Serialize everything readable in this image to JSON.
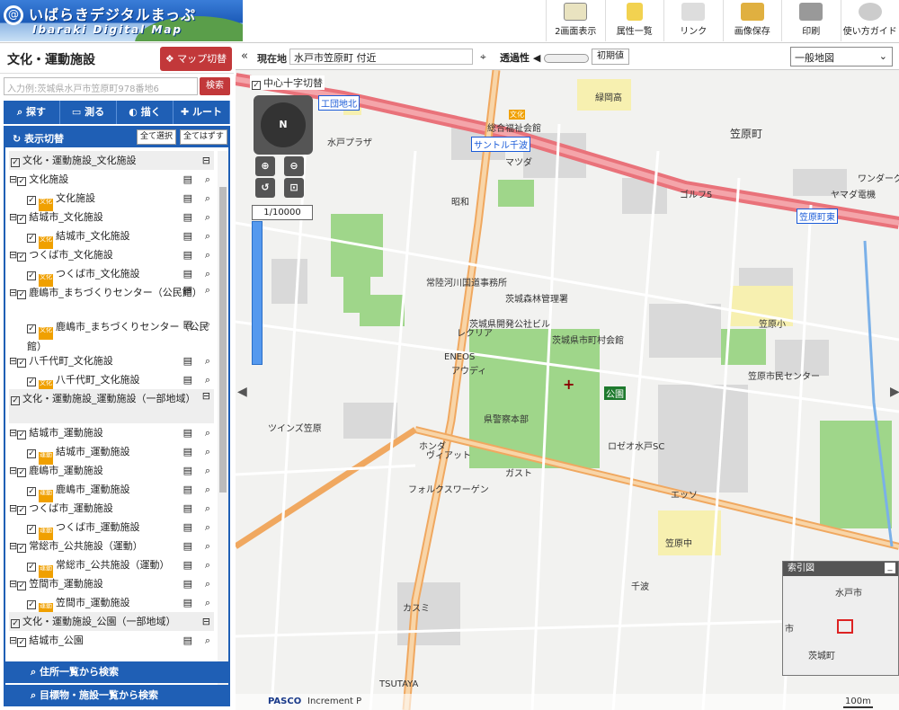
{
  "header": {
    "logo_main": "いばらきデジタルまっぷ",
    "logo_sub": "Ibaraki Digital Map",
    "toolbar": [
      "2画面表示",
      "属性一覧",
      "リンク",
      "画像保存",
      "印刷",
      "使い方ガイド"
    ]
  },
  "panel": {
    "title": "文化・運動施設",
    "map_switch": "マップ切替",
    "search_placeholder": "入力例:茨城県水戸市笠原町978番地6",
    "search_button": "検索",
    "tools": [
      "探す",
      "測る",
      "描く",
      "ルート"
    ],
    "display_toggle": "表示切替",
    "select_all": "全て選択",
    "deselect_all": "全てはずす",
    "badge_culture": "文化",
    "badge_sports": "運動",
    "rows": [
      {
        "type": "group",
        "label": "文化・運動施設_文化施設"
      },
      {
        "type": "parent",
        "label": "文化施設"
      },
      {
        "type": "child",
        "label": "文化施設",
        "badge": "culture"
      },
      {
        "type": "parent",
        "label": "結城市_文化施設"
      },
      {
        "type": "child",
        "label": "結城市_文化施設",
        "badge": "culture"
      },
      {
        "type": "parent",
        "label": "つくば市_文化施設"
      },
      {
        "type": "child",
        "label": "つくば市_文化施設",
        "badge": "culture"
      },
      {
        "type": "parent",
        "label": "鹿嶋市_まちづくりセンター（公民館）",
        "tall": true
      },
      {
        "type": "child",
        "label": "鹿嶋市_まちづくりセンター（公民館）",
        "badge": "culture",
        "tall": true
      },
      {
        "type": "parent",
        "label": "八千代町_文化施設"
      },
      {
        "type": "child",
        "label": "八千代町_文化施設",
        "badge": "culture"
      },
      {
        "type": "group",
        "label": "文化・運動施設_運動施設（一部地域）",
        "tall": true
      },
      {
        "type": "parent",
        "label": "結城市_運動施設"
      },
      {
        "type": "child",
        "label": "結城市_運動施設",
        "badge": "sports"
      },
      {
        "type": "parent",
        "label": "鹿嶋市_運動施設"
      },
      {
        "type": "child",
        "label": "鹿嶋市_運動施設",
        "badge": "sports"
      },
      {
        "type": "parent",
        "label": "つくば市_運動施設"
      },
      {
        "type": "child",
        "label": "つくば市_運動施設",
        "badge": "sports"
      },
      {
        "type": "parent",
        "label": "常総市_公共施設（運動）"
      },
      {
        "type": "child",
        "label": "常総市_公共施設（運動）",
        "badge": "sports"
      },
      {
        "type": "parent",
        "label": "笠間市_運動施設"
      },
      {
        "type": "child",
        "label": "笠間市_運動施設",
        "badge": "sports"
      },
      {
        "type": "group",
        "label": "文化・運動施設_公園（一部地域）"
      },
      {
        "type": "parent",
        "label": "結城市_公園"
      }
    ],
    "bottom_address": "住所一覧から検索",
    "bottom_landmark": "目標物・施設一覧から検索"
  },
  "map": {
    "location_label": "現在地",
    "location_value": "水戸市笠原町 付近",
    "opacity_label": "透過性",
    "init_button": "初期値",
    "map_type": "一般地図",
    "crosshair_label": "中心十字切替",
    "scale": "1/10000",
    "overview_title": "索引図",
    "overview_labels": [
      "水戸市",
      "茨城町",
      "市"
    ],
    "labels": [
      "緑岡高",
      "笠原町",
      "水戸プラザ",
      "サントル千波",
      "マツダ",
      "ガスト",
      "ワンダーグー",
      "ヤマダ電機",
      "ゴルフ5",
      "笠原町東",
      "茨城森林管理署",
      "笠原小",
      "常陸河川国道事務所",
      "茨城県開発公社ビル",
      "レクリア",
      "茨城県市町村会館",
      "ENEOS",
      "アウディ",
      "笠原市民センター",
      "県警察本部",
      "ロゼオ水戸SC",
      "公園",
      "ツインズ笠原",
      "ホンダ",
      "ヴィアット",
      "フォルクスワーゲン",
      "エッソ",
      "笠原中",
      "カスミ",
      "TSUTAYA",
      "千波",
      "工団地北",
      "総合福祉会館",
      "昭和",
      "文化"
    ],
    "footer_left": "PASCO",
    "footer_mid": "Increment P",
    "scalebar": "100m"
  },
  "colors": {
    "accent_red": "#c2383a",
    "accent_blue": "#1f5fb5",
    "park_green": "#9fd68a",
    "school_yellow": "#f7f0b0",
    "highway_red": "#e9727a",
    "main_road": "#f5c48a"
  }
}
